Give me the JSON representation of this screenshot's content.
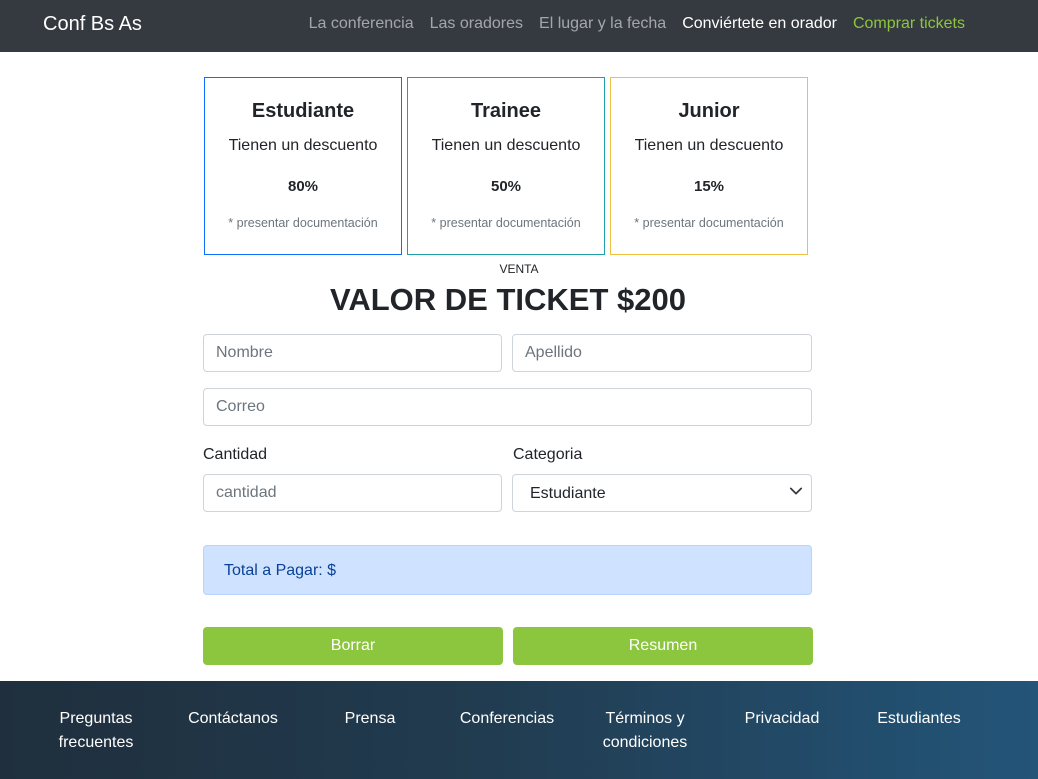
{
  "navbar": {
    "brand": "Conf Bs As",
    "links": [
      {
        "label": "La conferencia"
      },
      {
        "label": "Las oradores"
      },
      {
        "label": "El lugar y la fecha"
      },
      {
        "label": "Conviértete en orador"
      },
      {
        "label": "Comprar tickets"
      }
    ]
  },
  "cards": [
    {
      "title": "Estudiante",
      "text": "Tienen un descuento",
      "discount": "80%",
      "note": "* presentar documentación",
      "border_color": "#0d6efd"
    },
    {
      "title": "Trainee",
      "text": "Tienen un descuento",
      "discount": "50%",
      "note": "* presentar documentación",
      "border_color": "#20a0a8"
    },
    {
      "title": "Junior",
      "text": "Tienen un descuento",
      "discount": "15%",
      "note": "* presentar documentación",
      "border_color": "#f0c040"
    }
  ],
  "sale": {
    "eyebrow": "VENTA",
    "title": "VALOR DE TICKET $200"
  },
  "form": {
    "nombre_placeholder": "Nombre",
    "apellido_placeholder": "Apellido",
    "correo_placeholder": "Correo",
    "cantidad_label": "Cantidad",
    "cantidad_placeholder": "cantidad",
    "categoria_label": "Categoria",
    "categoria_selected": "Estudiante"
  },
  "total": {
    "text": "Total a Pagar: $"
  },
  "buttons": {
    "borrar": "Borrar",
    "resumen": "Resumen"
  },
  "footer": {
    "items": [
      {
        "label": "Preguntas frecuentes"
      },
      {
        "label": "Contáctanos"
      },
      {
        "label": "Prensa"
      },
      {
        "label": "Conferencias"
      },
      {
        "label": "Términos y condiciones"
      },
      {
        "label": "Privacidad"
      },
      {
        "label": "Estudiantes"
      }
    ]
  },
  "colors": {
    "navbar_bg": "#343a40",
    "accent_green": "#8cc63f",
    "alert_bg": "#cfe2ff"
  }
}
